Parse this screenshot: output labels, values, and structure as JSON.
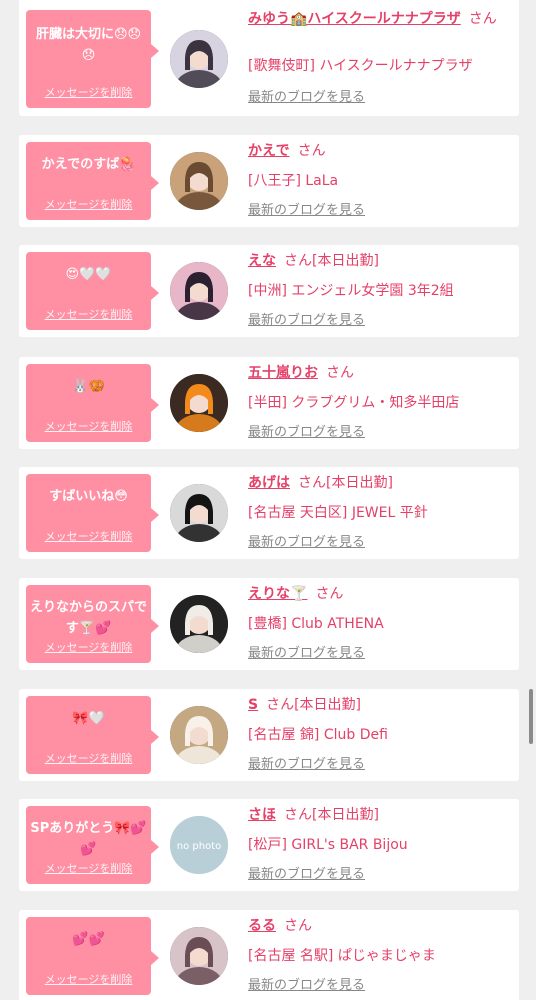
{
  "cards": [
    {
      "message": "肝臓は大切に😞😞😞",
      "delete_label": "メッセージを削除",
      "name": "みゆう🏫ハイスクールナナプラザ",
      "san": "さん",
      "status": "",
      "shop": "[歌舞伎町] ハイスクールナナプラザ",
      "blog_label": "最新のブログを見る",
      "avatar": "photo"
    },
    {
      "message": "かえでのすば🪼",
      "delete_label": "メッセージを削除",
      "name": "かえで",
      "san": "さん",
      "status": "",
      "shop": "[八王子] LaLa",
      "blog_label": "最新のブログを見る",
      "avatar": "photo"
    },
    {
      "message": "😍🤍🤍",
      "delete_label": "メッセージを削除",
      "name": "えな",
      "san": "さん",
      "status": "[本日出勤]",
      "shop": "[中洲] エンジェル女学園 3年2組",
      "blog_label": "最新のブログを見る",
      "avatar": "photo"
    },
    {
      "message": "🐰🥨",
      "delete_label": "メッセージを削除",
      "name": "五十嵐りお",
      "san": "さん",
      "status": "",
      "shop": "[半田] クラブグリム・知多半田店",
      "blog_label": "最新のブログを見る",
      "avatar": "photo"
    },
    {
      "message": "すばいいね😳",
      "delete_label": "メッセージを削除",
      "name": "あげは",
      "san": "さん",
      "status": "[本日出勤]",
      "shop": "[名古屋 天白区] JEWEL 平針",
      "blog_label": "最新のブログを見る",
      "avatar": "photo"
    },
    {
      "message": "えりなからのスパです🍸💕",
      "delete_label": "メッセージを削除",
      "name": "えりな🍸",
      "san": "さん",
      "status": "",
      "shop": "[豊橋] Club ATHENA",
      "blog_label": "最新のブログを見る",
      "avatar": "photo"
    },
    {
      "message": "🎀🤍",
      "delete_label": "メッセージを削除",
      "name": "S",
      "san": "さん",
      "status": "[本日出勤]",
      "shop": "[名古屋 錦] Club Defi",
      "blog_label": "最新のブログを見る",
      "avatar": "photo"
    },
    {
      "message": "SPありがとう🎀💕💕",
      "delete_label": "メッセージを削除",
      "name": "さほ",
      "san": "さん",
      "status": "[本日出勤]",
      "shop": "[松戸] GIRL's BAR Bijou",
      "blog_label": "最新のブログを見る",
      "avatar": "nophoto",
      "avatar_text": "no photo"
    },
    {
      "message": "💕💕",
      "delete_label": "メッセージを削除",
      "name": "るる",
      "san": "さん",
      "status": "",
      "shop": "[名古屋 名駅] ぱじゃまじゃま",
      "blog_label": "最新のブログを見る",
      "avatar": "photo"
    }
  ],
  "colors": {
    "accent": "#e54068",
    "bubble": "#ff8fa3",
    "page_bg": "#efefef",
    "link_gray": "#888888"
  }
}
